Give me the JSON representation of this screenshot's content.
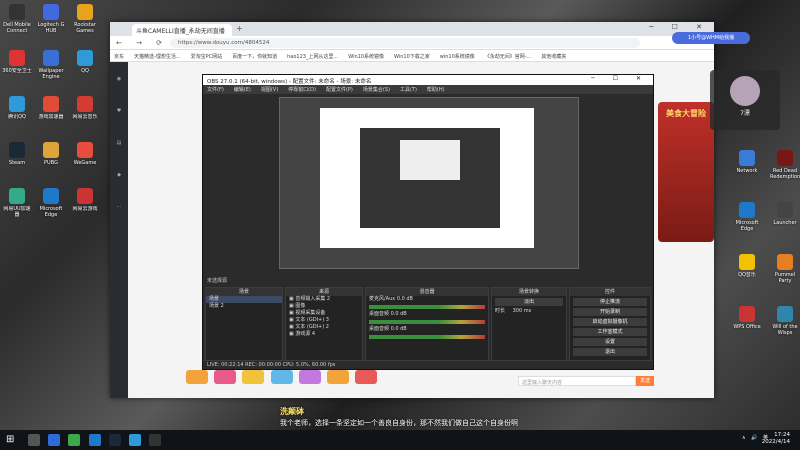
{
  "desktop": {
    "left_icons": [
      {
        "label": "Dell Mobile Connect",
        "color": "#333"
      },
      {
        "label": "Logitech G HUB",
        "color": "#4169e1"
      },
      {
        "label": "Rockstar Games",
        "color": "#e8a31a"
      },
      {
        "label": "360安全卫士",
        "color": "#d33"
      },
      {
        "label": "Wallpaper Engine",
        "color": "#3a6fd6"
      },
      {
        "label": "QQ",
        "color": "#2f9ad9"
      },
      {
        "label": "腾讯QQ",
        "color": "#2f9ad9"
      },
      {
        "label": "游戏加速器",
        "color": "#e04b37"
      },
      {
        "label": "网易云音乐",
        "color": "#d43c33"
      },
      {
        "label": "Steam",
        "color": "#1b2838"
      },
      {
        "label": "PUBG",
        "color": "#dca43b"
      },
      {
        "label": "WeGame",
        "color": "#e84c3d"
      },
      {
        "label": "网易UU加速器",
        "color": "#33aa88"
      },
      {
        "label": "Microsoft Edge",
        "color": "#1f78c9"
      },
      {
        "label": "网易云游戏",
        "color": "#c33"
      }
    ],
    "right_icons": [
      {
        "label": "Network",
        "color": "#3a7bd5"
      },
      {
        "label": "Microsoft Edge",
        "color": "#1f78c9"
      },
      {
        "label": "QQ音乐",
        "color": "#f2c200"
      },
      {
        "label": "WPS Office",
        "color": "#c33"
      },
      {
        "label": "Red Dead Redemption",
        "color": "#7a1616"
      },
      {
        "label": "Launcher",
        "color": "#444"
      },
      {
        "label": "Pummel Party",
        "color": "#e67e22"
      },
      {
        "label": "Will of the Wisps",
        "color": "#2e86ab"
      }
    ]
  },
  "browser": {
    "tab_title": "斗鱼CAMELLI直播_永劫无间直播",
    "url": "https://www.douyu.com/4804524",
    "bookmarks": [
      "京东",
      "天猫精选-理想生活...",
      "爱淘宝PC网站",
      "百度一下，你就知道",
      "hao123_上网从这里...",
      "Win10系统镜像",
      "Win10下载之家",
      "win10系统镜像",
      "《永劫无间》官网-...",
      "其他收藏夹"
    ]
  },
  "obs": {
    "title": "OBS 27.0.1 (64-bit, windows) - 配置文件: 未命名 - 场景: 未命名",
    "menu": [
      "文件(F)",
      "编辑(E)",
      "视图(V)",
      "停靠窗口(D)",
      "配置文件(P)",
      "场景集合(S)",
      "工具(T)",
      "帮助(H)"
    ],
    "selected_source": "未选择源",
    "docks": {
      "scenes": {
        "header": "场景",
        "items": [
          "场景",
          "场景 2"
        ]
      },
      "sources": {
        "header": "来源",
        "items": [
          "音频输入采集 2",
          "图像",
          "视频采集设备",
          "文本 (GDI+) 3",
          "文本 (GDI+) 2",
          "游戏源 4"
        ]
      },
      "mixer": {
        "header": "混音器",
        "channels": [
          {
            "name": "麦克风/Aux",
            "level": "0.0 dB"
          },
          {
            "name": "桌面音频",
            "level": "0.0 dB"
          },
          {
            "name": "桌面音频",
            "level": "0.0 dB"
          }
        ]
      },
      "transitions": {
        "header": "场景转换",
        "type": "淡出",
        "duration_label": "时长",
        "duration": "300 ms"
      },
      "controls": {
        "header": "控件",
        "buttons": [
          "停止推流",
          "开始录制",
          "启动虚拟摄像机",
          "工作室模式",
          "设置",
          "退出"
        ]
      }
    },
    "status": "LIVE: 00:22:14   REC: 00:00:00   CPU: 5.0%, 60.00 fps"
  },
  "page": {
    "chat_placeholder": "这里输入聊天内容",
    "send_label": "发送",
    "subtitle_name": "洗颠砵",
    "subtitle_text": "我个老师，选择一条坚定如一个善良自身份，那不然我们做自己这个自身份啊"
  },
  "overlay": {
    "tip": "1小号@WHM给我播",
    "viewer_count": "7漂",
    "side_banner": "美食大冒险"
  },
  "taskbar": {
    "time": "17:24",
    "date": "2022/4/14",
    "tray": "∧ 🔊 英"
  }
}
